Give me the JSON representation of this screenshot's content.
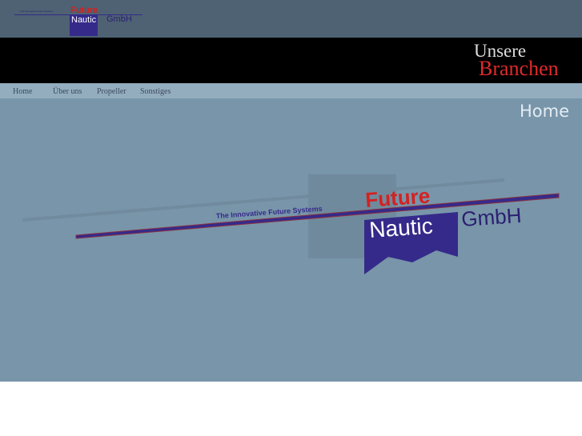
{
  "logo": {
    "tagline": "The Innovative Future Systems",
    "future": "Future",
    "nautic": "Nautic",
    "gmbh": "GmbH"
  },
  "banner": {
    "line1": "Unsere",
    "line2": "Branchen"
  },
  "nav": [
    {
      "label": "Home"
    },
    {
      "label": "Über uns"
    },
    {
      "label": "Propeller"
    },
    {
      "label": "Sonstiges"
    }
  ],
  "main": {
    "page_title": "Home"
  }
}
